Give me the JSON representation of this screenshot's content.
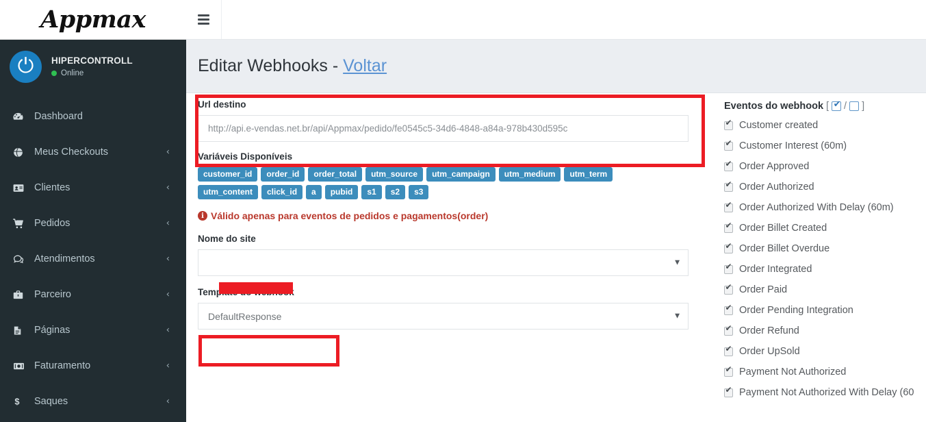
{
  "brand": {
    "name": "Appmax"
  },
  "sidebar": {
    "user": {
      "name": "HIPERCONTROLL",
      "status": "Online",
      "avatar_icon": "power-icon",
      "avatar_color": "#1a7fc1",
      "status_color": "#2fbf52"
    },
    "background_color": "#222d32",
    "items": [
      {
        "label": "Dashboard",
        "icon": "dashboard-icon",
        "caret": "",
        "has_caret": false
      },
      {
        "label": "Meus Checkouts",
        "icon": "globe-icon",
        "caret": "‹",
        "has_caret": true
      },
      {
        "label": "Clientes",
        "icon": "id-card-icon",
        "caret": "‹",
        "has_caret": true
      },
      {
        "label": "Pedidos",
        "icon": "cart-icon",
        "caret": "‹",
        "has_caret": true
      },
      {
        "label": "Atendimentos",
        "icon": "chat-icon",
        "caret": "‹",
        "has_caret": true
      },
      {
        "label": "Parceiro",
        "icon": "briefcase-icon",
        "caret": "‹",
        "has_caret": true
      },
      {
        "label": "Páginas",
        "icon": "file-icon",
        "caret": "‹",
        "has_caret": true
      },
      {
        "label": "Faturamento",
        "icon": "money-icon",
        "caret": "‹",
        "has_caret": true
      },
      {
        "label": "Saques",
        "icon": "dollar-icon",
        "caret": "‹",
        "has_caret": true
      }
    ]
  },
  "topbar": {
    "menu_icon": "hamburger-icon"
  },
  "page": {
    "title_main": "Editar Webhooks - ",
    "title_link": "Voltar"
  },
  "form": {
    "url_label": "Url destino",
    "url_value": "http://api.e-vendas.net.br/api/Appmax/pedido/fe0545c5-34d6-4848-a84a-978b430d595c",
    "vars_label": "Variáveis Disponíveis",
    "vars": [
      "customer_id",
      "order_id",
      "order_total",
      "utm_source",
      "utm_campaign",
      "utm_medium",
      "utm_term",
      "utm_content",
      "click_id",
      "a",
      "pubid",
      "s1",
      "s2",
      "s3"
    ],
    "warning_icon": "info-icon",
    "warning_text": "Válido apenas para eventos de pedidos e pagamentos(order)",
    "site_label": "Nome do site",
    "site_value": "",
    "site_redacted": true,
    "template_label": "Template do webhook",
    "template_value": "DefaultResponse",
    "caret_icon": "caret-down-icon"
  },
  "events": {
    "title": "Eventos do webhook",
    "bracket_open": "[",
    "bracket_sep": "/",
    "bracket_close": "]",
    "select_all_icon": "checkbox-checked-icon",
    "select_none_icon": "checkbox-empty-icon",
    "items": [
      {
        "label": "Customer created",
        "checked": true
      },
      {
        "label": "Customer Interest (60m)",
        "checked": true
      },
      {
        "label": "Order Approved",
        "checked": true
      },
      {
        "label": "Order Authorized",
        "checked": true
      },
      {
        "label": "Order Authorized With Delay (60m)",
        "checked": true
      },
      {
        "label": "Order Billet Created",
        "checked": true
      },
      {
        "label": "Order Billet Overdue",
        "checked": true
      },
      {
        "label": "Order Integrated",
        "checked": true
      },
      {
        "label": "Order Paid",
        "checked": true
      },
      {
        "label": "Order Pending Integration",
        "checked": true
      },
      {
        "label": "Order Refund",
        "checked": true
      },
      {
        "label": "Order UpSold",
        "checked": true
      },
      {
        "label": "Payment Not Authorized",
        "checked": true
      },
      {
        "label": "Payment Not Authorized With Delay (60",
        "checked": true
      }
    ]
  },
  "annotations": {
    "color": "#ec1c24",
    "boxes": [
      {
        "name": "url-destino-highlight"
      },
      {
        "name": "template-webhook-highlight"
      }
    ],
    "redaction": {
      "name": "site-name-redaction"
    }
  },
  "colors": {
    "sidebar": "#222d32",
    "tag": "#3c8dbc",
    "link": "#5b93d3",
    "warning": "#b9382c",
    "annotation": "#ec1c24"
  }
}
